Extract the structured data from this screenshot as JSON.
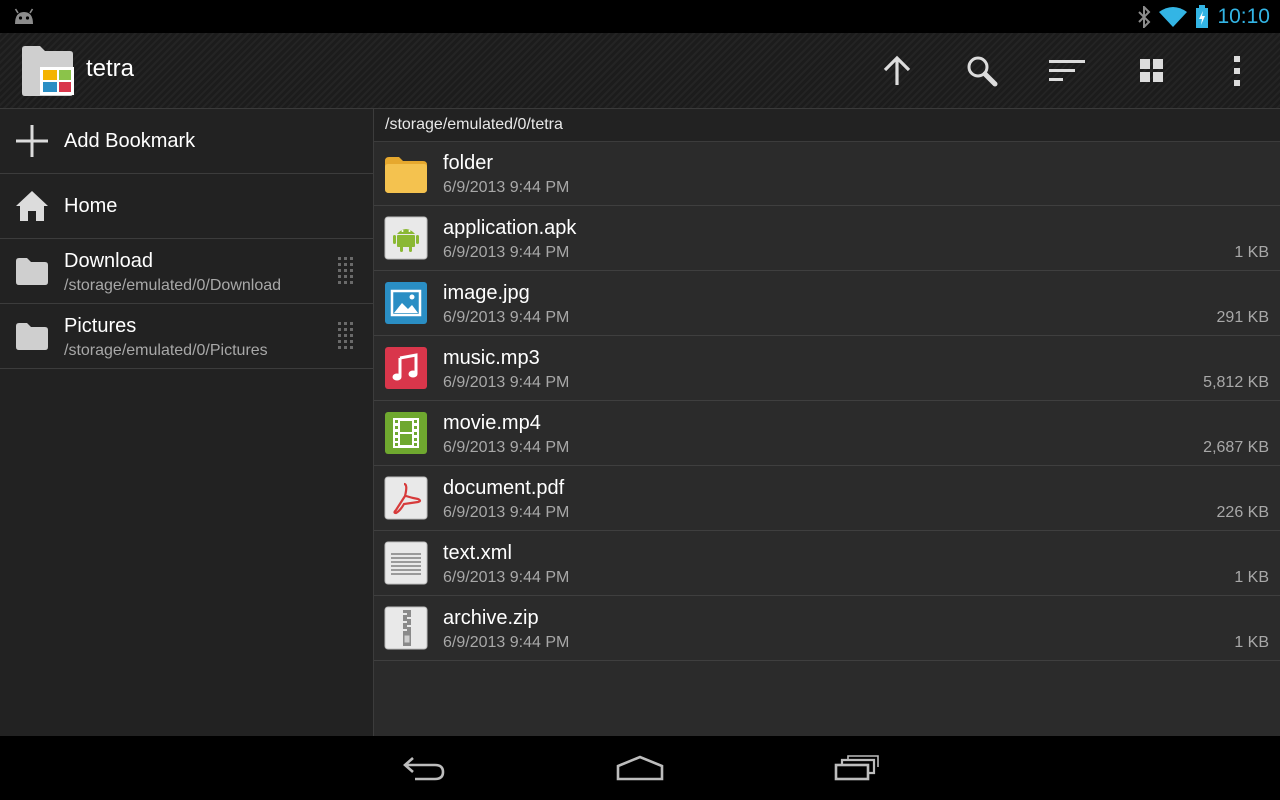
{
  "status_bar": {
    "time": "10:10"
  },
  "app": {
    "title": "tetra"
  },
  "toolbar": {
    "actions": [
      "up-arrow-icon",
      "search-icon",
      "sort-icon",
      "grid-view-icon",
      "overflow-menu-icon"
    ]
  },
  "sidebar": {
    "add_bookmark": "Add Bookmark",
    "home": "Home",
    "bookmarks": [
      {
        "label": "Download",
        "path": "/storage/emulated/0/Download"
      },
      {
        "label": "Pictures",
        "path": "/storage/emulated/0/Pictures"
      }
    ]
  },
  "path": "/storage/emulated/0/tetra",
  "files": [
    {
      "name": "folder",
      "date": "6/9/2013  9:44 PM",
      "size": "",
      "icon": "folder-icon"
    },
    {
      "name": "application.apk",
      "date": "6/9/2013  9:44 PM",
      "size": "1 KB",
      "icon": "android-apk-icon"
    },
    {
      "name": "image.jpg",
      "date": "6/9/2013  9:44 PM",
      "size": "291 KB",
      "icon": "image-file-icon"
    },
    {
      "name": "music.mp3",
      "date": "6/9/2013  9:44 PM",
      "size": "5,812 KB",
      "icon": "music-file-icon"
    },
    {
      "name": "movie.mp4",
      "date": "6/9/2013  9:44 PM",
      "size": "2,687 KB",
      "icon": "video-file-icon"
    },
    {
      "name": "document.pdf",
      "date": "6/9/2013  9:44 PM",
      "size": "226 KB",
      "icon": "pdf-file-icon"
    },
    {
      "name": "text.xml",
      "date": "6/9/2013  9:44 PM",
      "size": "1 KB",
      "icon": "text-file-icon"
    },
    {
      "name": "archive.zip",
      "date": "6/9/2013  9:44 PM",
      "size": "1 KB",
      "icon": "archive-file-icon"
    }
  ],
  "colors": {
    "accent": "#33b5e5",
    "music": "#d9364b",
    "image": "#2a8ec4",
    "video": "#6fa82f",
    "folder": "#f4c24f"
  }
}
